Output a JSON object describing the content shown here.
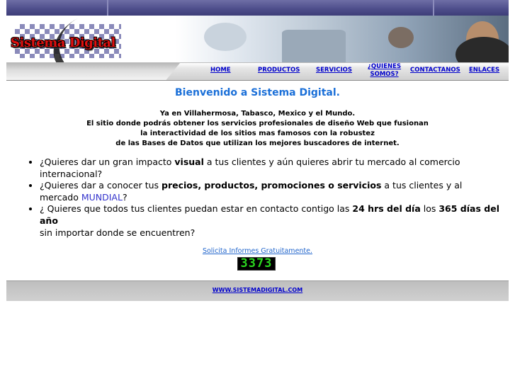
{
  "header": {
    "logo_text": "Sistema Digital"
  },
  "nav": {
    "items": [
      {
        "label": "HOME"
      },
      {
        "label": "PRODUCTOS"
      },
      {
        "label": "SERVICIOS"
      },
      {
        "label_line1": "¿QUIENES",
        "label_line2": "SOMOS?"
      },
      {
        "label": "CONTACTANOS"
      },
      {
        "label": "ENLACES"
      }
    ]
  },
  "content": {
    "welcome": "Bienvenido a Sistema Digital.",
    "intro_lines": [
      "Ya en Villahermosa, Tabasco, Mexico y el Mundo.",
      "El sitio donde podrás obtener los servicios profesionales de diseño Web que fusionan",
      "la interactividad de los sitios mas famosos con la robustez",
      "de las Bases de Datos que utilizan los mejores buscadores de internet."
    ],
    "features": [
      {
        "pre": "¿Quieres dar un gran impacto ",
        "bold": "visual",
        "post": " a tus clientes y aún quieres abrir tu mercado al comercio internacional?"
      },
      {
        "pre": "¿Quieres dar a conocer tus ",
        "bold": "precios, productos, promociones o servicios",
        "mid": " a tus clientes y al mercado ",
        "highlight": "MUNDIAL",
        "post": "?"
      },
      {
        "pre": "¿ Quieres que todos tus clientes puedan estar en contacto contigo las ",
        "bold": "24 hrs del día",
        "mid": " los ",
        "bold2": "365 días del año",
        "post": "sin importar donde se encuentren?"
      }
    ],
    "request_link": "Solicita Informes Gratuitamente.",
    "counter": "3373"
  },
  "footer": {
    "link": "WWW.SISTEMADIGITAL.COM"
  },
  "colors": {
    "top_strip": "#4f4f8c",
    "welcome": "#1a6fd8",
    "link": "#0000cc",
    "counter_digits": "#2bd81f",
    "logo": "#e01010"
  }
}
